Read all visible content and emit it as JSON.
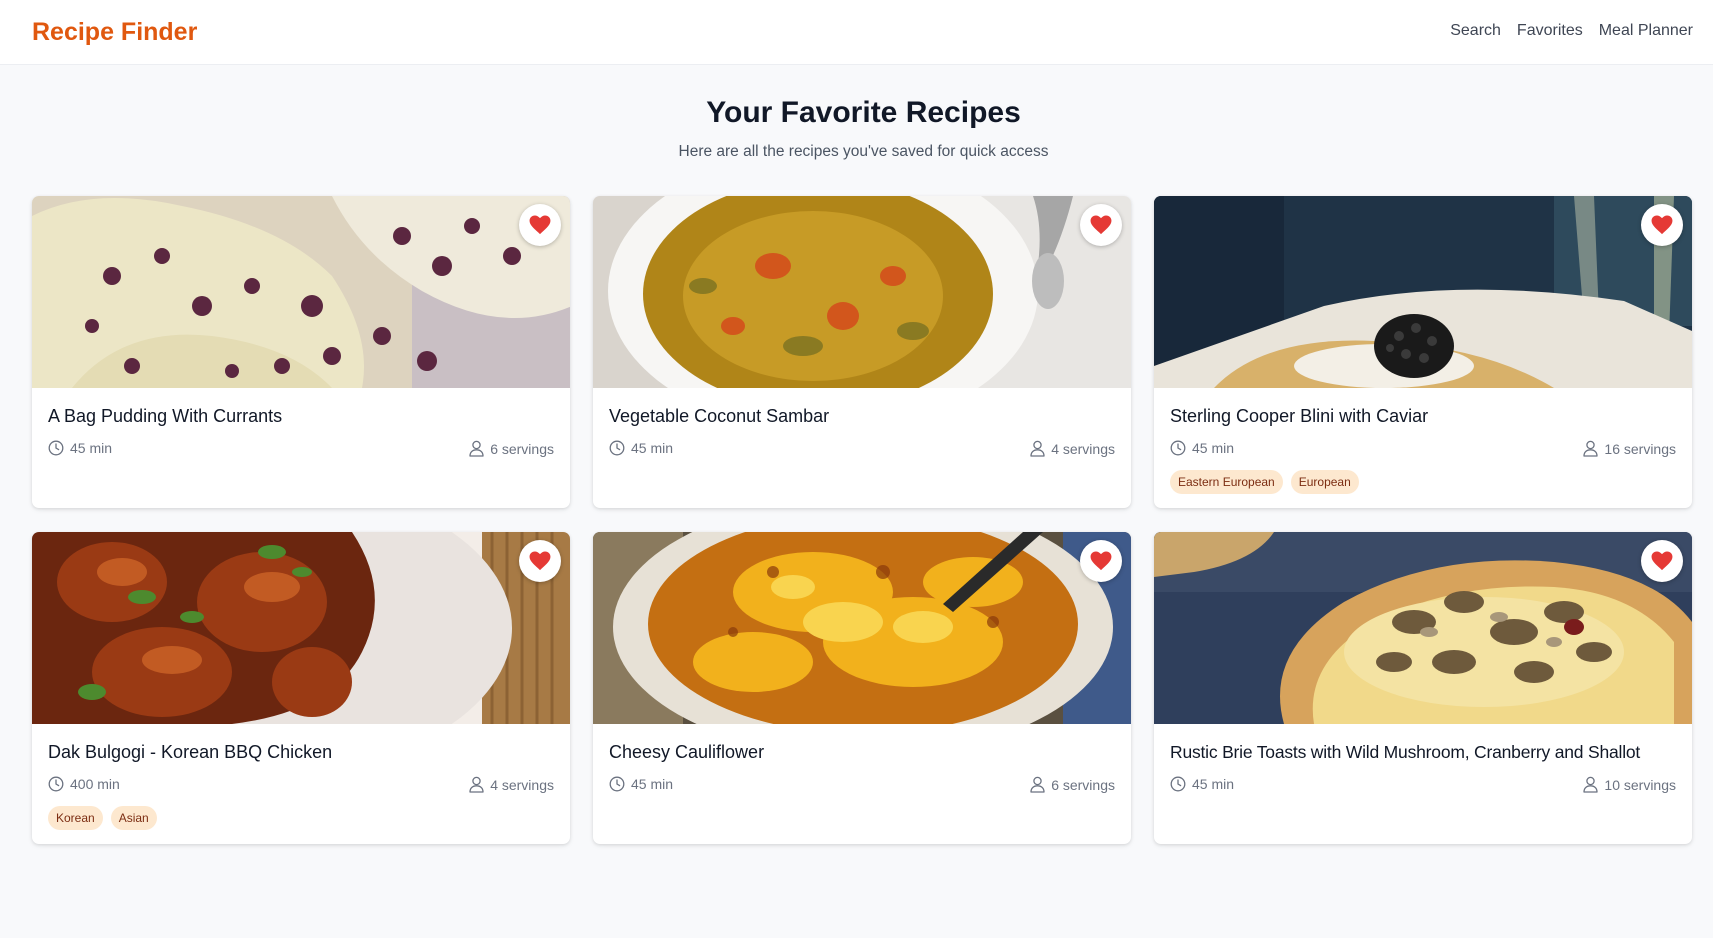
{
  "header": {
    "brand": "Recipe Finder",
    "nav": [
      "Search",
      "Favorites",
      "Meal Planner"
    ]
  },
  "page": {
    "title": "Your Favorite Recipes",
    "subtitle": "Here are all the recipes you've saved for quick access"
  },
  "colors": {
    "brand": "#e0580f",
    "heart": "#e53935",
    "tag_bg": "#fde8cf",
    "tag_text": "#7c2d12"
  },
  "recipes": [
    {
      "title": "A Bag Pudding With Currants",
      "time": "45 min",
      "servings": "6 servings",
      "tags": [],
      "favorited": true,
      "image_icon": "pudding-photo"
    },
    {
      "title": "Vegetable Coconut Sambar",
      "time": "45 min",
      "servings": "4 servings",
      "tags": [],
      "favorited": true,
      "image_icon": "sambar-photo"
    },
    {
      "title": "Sterling Cooper Blini with Caviar",
      "time": "45 min",
      "servings": "16 servings",
      "tags": [
        "Eastern European",
        "European"
      ],
      "favorited": true,
      "image_icon": "blini-photo"
    },
    {
      "title": "Dak Bulgogi - Korean BBQ Chicken",
      "time": "400 min",
      "servings": "4 servings",
      "tags": [
        "Korean",
        "Asian"
      ],
      "favorited": true,
      "image_icon": "chicken-photo"
    },
    {
      "title": "Cheesy Cauliflower",
      "time": "45 min",
      "servings": "6 servings",
      "tags": [],
      "favorited": true,
      "image_icon": "cauliflower-photo"
    },
    {
      "title": "Rustic Brie Toasts with Wild Mushroom, Cranberry and Shallot",
      "time": "45 min",
      "servings": "10 servings",
      "tags": [],
      "favorited": true,
      "image_icon": "brie-toast-photo"
    }
  ]
}
